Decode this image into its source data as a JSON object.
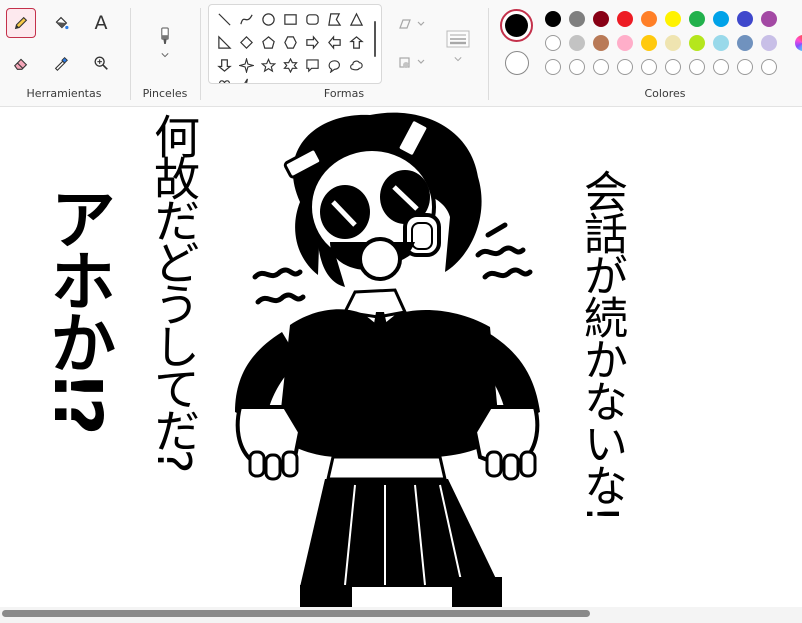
{
  "groups": {
    "tools": "Herramientas",
    "brushes": "Pinceles",
    "shapes": "Formas",
    "colors": "Colores"
  },
  "tool_names": {
    "text": "A"
  },
  "palette": {
    "row1": [
      "#000000",
      "#7f7f7f",
      "#880015",
      "#ed1c24",
      "#ff7f27",
      "#fff200",
      "#22b14c",
      "#00a2e8",
      "#3f48cc",
      "#a349a4"
    ],
    "row2": [
      "#ffffff",
      "#c3c3c3",
      "#b97a57",
      "#ffaec9",
      "#ffc90e",
      "#efe4b0",
      "#b5e61d",
      "#99d9ea",
      "#7092be",
      "#c8bfe7"
    ],
    "primary": "#000000",
    "secondary": "#ffffff"
  },
  "drawing": {
    "text_left_big": "アホか!?",
    "text_left_middle": "何故だどうしてだ?",
    "text_right": "会話が続かないな!"
  }
}
